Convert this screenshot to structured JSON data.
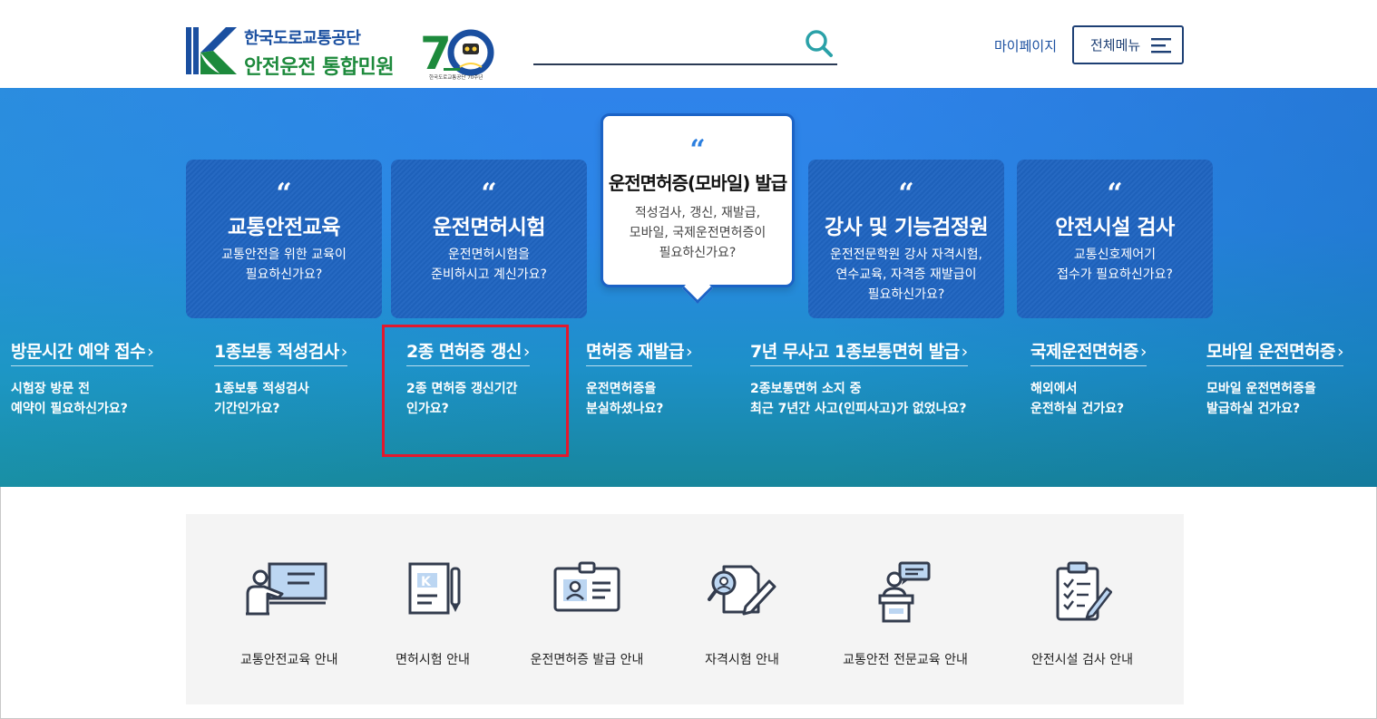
{
  "header": {
    "org_name": "한국도로교통공단",
    "service_name": "안전운전 통합민원",
    "anniversary_caption": "한국도로교통공단 70주년",
    "search": {
      "value": "",
      "placeholder": ""
    },
    "mypage_label": "마이페이지",
    "allmenu_label": "전체메뉴"
  },
  "cards": [
    {
      "title": "교통안전교육",
      "desc1": "교통안전을 위한 교육이",
      "desc2": "필요하신가요?",
      "desc3": ""
    },
    {
      "title": "운전면허시험",
      "desc1": "운전면허시험을",
      "desc2": "준비하시고 계신가요?",
      "desc3": ""
    },
    {
      "title": "운전면허증(모바일) 발급",
      "desc1": "적성검사, 갱신, 재발급,",
      "desc2": "모바일, 국제운전면허증이",
      "desc3": "필요하신가요?"
    },
    {
      "title": "강사 및 기능검정원",
      "desc1": "운전전문학원 강사 자격시험,",
      "desc2": "연수교육, 자격증 재발급이",
      "desc3": "필요하신가요?"
    },
    {
      "title": "안전시설 검사",
      "desc1": "교통신호제어기",
      "desc2": "접수가 필요하신가요?",
      "desc3": ""
    }
  ],
  "quick_links": [
    {
      "title": "방문시간 예약 접수",
      "desc1": "시험장 방문 전",
      "desc2": "예약이 필요하신가요?"
    },
    {
      "title": "1종보통 적성검사",
      "desc1": "1종보통 적성검사",
      "desc2": "기간인가요?"
    },
    {
      "title": "2종 면허증 갱신",
      "desc1": "2종 면허증 갱신기간",
      "desc2": "인가요?"
    },
    {
      "title": "면허증 재발급",
      "desc1": "운전면허증을",
      "desc2": "분실하셨나요?"
    },
    {
      "title": "7년 무사고 1종보통면허 발급",
      "desc1": "2종보통면허 소지 중",
      "desc2": "최근 7년간 사고(인피사고)가 없었나요?"
    },
    {
      "title": "국제운전면허증",
      "desc1": "해외에서",
      "desc2": "운전하실 건가요?"
    },
    {
      "title": "모바일 운전면허증",
      "desc1": "모바일 운전면허증을",
      "desc2": "발급하실 건가요?"
    }
  ],
  "chevron": "›",
  "quote_mark": "“",
  "services": [
    {
      "label": "교통안전교육 안내",
      "icon": "lecture-icon"
    },
    {
      "label": "면허시험 안내",
      "icon": "license-exam-icon"
    },
    {
      "label": "운전면허증 발급 안내",
      "icon": "id-card-icon"
    },
    {
      "label": "자격시험 안내",
      "icon": "qualification-exam-icon"
    },
    {
      "label": "교통안전 전문교육 안내",
      "icon": "speaker-podium-icon"
    },
    {
      "label": "안전시설 검사 안내",
      "icon": "checklist-icon"
    }
  ],
  "colors": {
    "brand_blue": "#1a4fa0",
    "brand_green": "#1d8a3c",
    "hero_blue": "#2f83ea",
    "card_blue": "#1f64c0",
    "highlight_red": "#e3182d",
    "accent_teal": "#2aa1a8"
  }
}
